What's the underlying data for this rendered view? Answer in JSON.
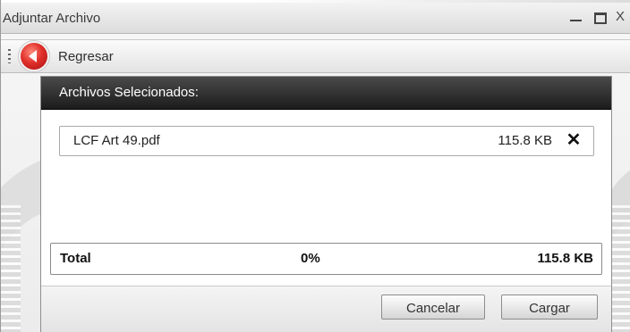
{
  "window": {
    "title": "Adjuntar Archivo",
    "controls": {
      "minimize": "minimize-icon",
      "maximize": "maximize-icon",
      "close": "X"
    }
  },
  "toolbar": {
    "back_label": "Regresar",
    "back_icon": "back-arrow-icon"
  },
  "panel": {
    "header": "Archivos Selecionados:",
    "files": [
      {
        "name": "LCF Art 49.pdf",
        "size": "115.8 KB",
        "remove_icon": "close-icon"
      }
    ],
    "total": {
      "label": "Total",
      "progress": "0%",
      "size": "115.8 KB"
    }
  },
  "buttons": {
    "cancel": "Cancelar",
    "upload": "Cargar"
  },
  "colors": {
    "header_bg": "#1c1c1c",
    "back_icon_red": "#e0302a"
  }
}
